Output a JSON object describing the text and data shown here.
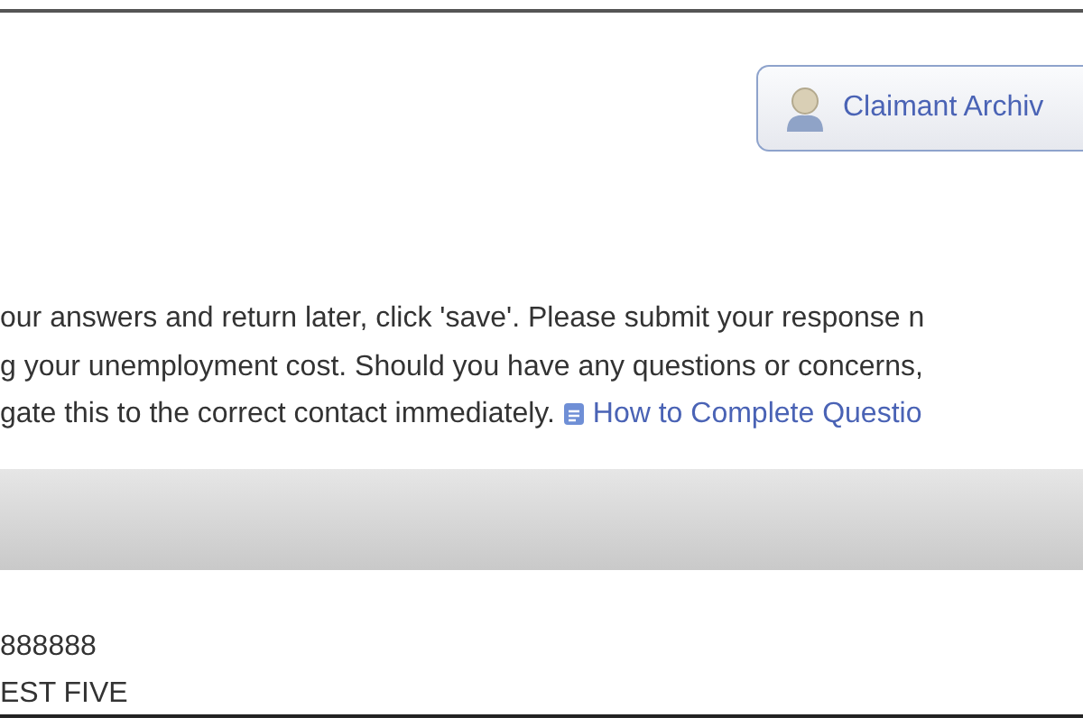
{
  "toolbar": {
    "archive_button": {
      "label": "Claimant Archiv"
    }
  },
  "instructions": {
    "lines": [
      "our answers and return later, click 'save'. Please submit your response n",
      "g your unemployment cost. Should you have any questions or concerns,",
      "gate this to the correct contact immediately."
    ],
    "link": "How to Complete Questio"
  },
  "details": [
    "888888",
    "EST FIVE"
  ]
}
